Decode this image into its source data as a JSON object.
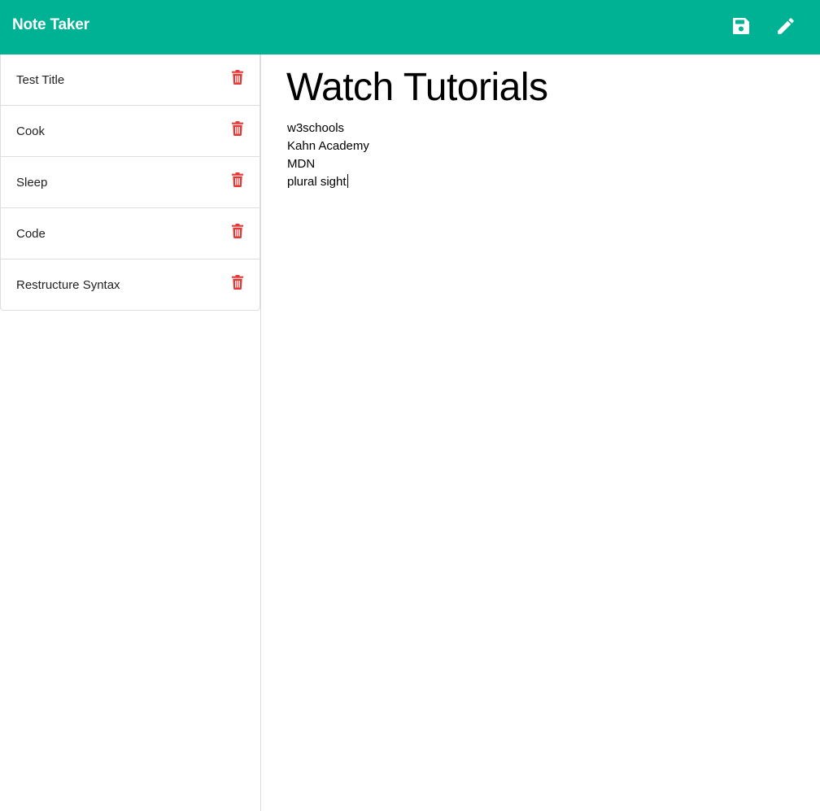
{
  "header": {
    "brand": "Note Taker",
    "save_icon": "save-icon",
    "new_note_icon": "pencil-icon",
    "bg_color": "#00b294"
  },
  "sidebar": {
    "notes": [
      {
        "title": "Test Title"
      },
      {
        "title": "Cook"
      },
      {
        "title": "Sleep"
      },
      {
        "title": "Code"
      },
      {
        "title": "Restructure Syntax"
      }
    ],
    "delete_icon": "trash-icon",
    "delete_color": "#e53935"
  },
  "editor": {
    "title": "Watch Tutorials",
    "lines": [
      "w3schools",
      "Kahn Academy",
      "MDN",
      "plural sight"
    ]
  }
}
